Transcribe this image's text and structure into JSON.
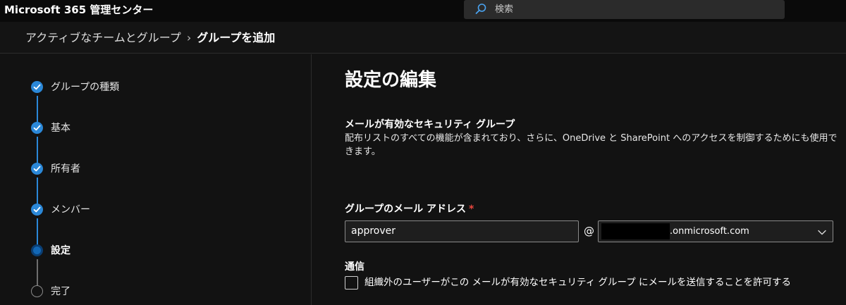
{
  "app": {
    "title": "Microsoft 365 管理センター"
  },
  "search": {
    "placeholder": "検索",
    "icon": "search-icon"
  },
  "breadcrumb": {
    "parent": "アクティブなチームとグループ",
    "separator": "›",
    "current": "グループを追加"
  },
  "stepper": {
    "steps": [
      {
        "label": "グループの種類",
        "state": "done"
      },
      {
        "label": "基本",
        "state": "done"
      },
      {
        "label": "所有者",
        "state": "done"
      },
      {
        "label": "メンバー",
        "state": "done"
      },
      {
        "label": "設定",
        "state": "current"
      },
      {
        "label": "完了",
        "state": "todo"
      }
    ]
  },
  "main": {
    "title": "設定の編集",
    "group_type": {
      "title": "メールが有効なセキュリティ グループ",
      "description": "配布リストのすべての機能が含まれており、さらに、OneDrive と SharePoint へのアクセスを制御するためにも使用できます。"
    },
    "email": {
      "label": "グループのメール アドレス",
      "required_mark": "*",
      "value": "approver",
      "at": "@",
      "domain_suffix": ".onmicrosoft.com"
    },
    "communication": {
      "label": "通信",
      "checkbox_label": "組織外のユーザーがこの メールが有効なセキュリティ グループ にメールを送信することを許可する",
      "checked": false
    }
  },
  "colors": {
    "accent": "#2b88d8",
    "required": "#e9473f",
    "background": "#121212"
  }
}
